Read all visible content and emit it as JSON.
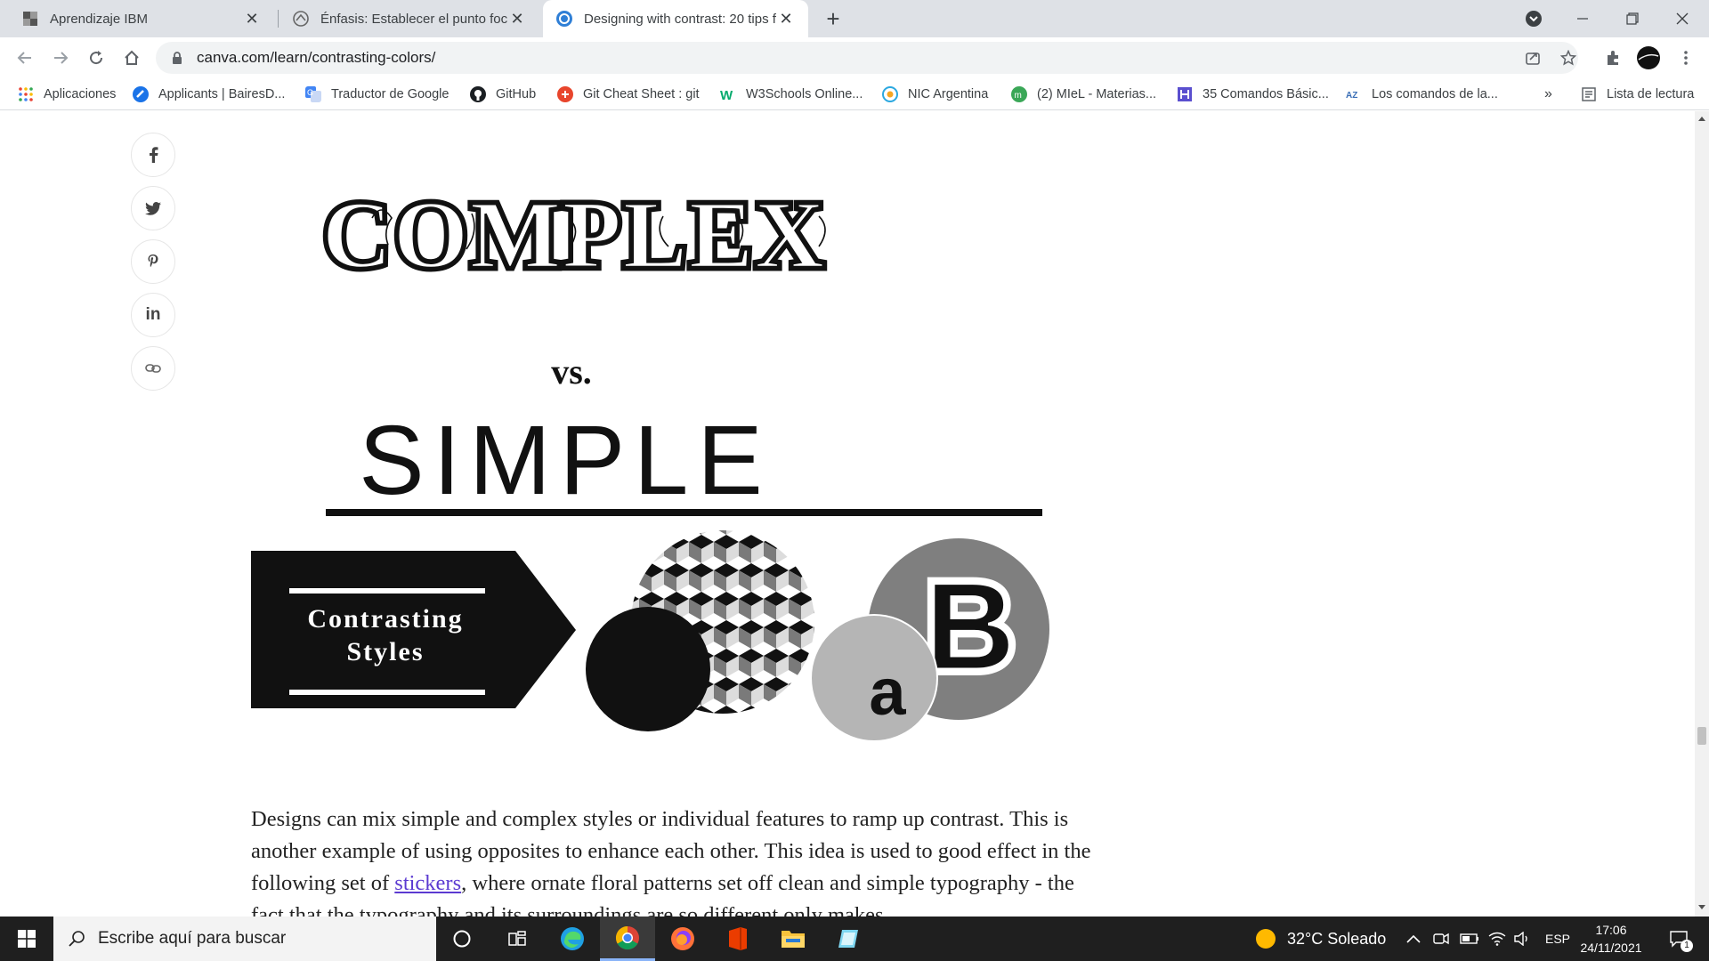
{
  "browser": {
    "tabs": [
      {
        "title": "Aprendizaje IBM",
        "active": false,
        "favicon": "ibm-icon"
      },
      {
        "title": "Énfasis: Establecer el punto focal",
        "active": false,
        "favicon": "atlas-icon"
      },
      {
        "title": "Designing with contrast: 20 tips f",
        "active": true,
        "favicon": "canva-icon"
      }
    ],
    "new_tab": "+",
    "url": "canva.com/learn/contrasting-colors/",
    "bookmarks": [
      {
        "label": "Aplicaciones",
        "icon": "apps-grid-icon"
      },
      {
        "label": "Applicants | BairesD...",
        "icon": "bairesdev-icon"
      },
      {
        "label": "Traductor de Google",
        "icon": "translate-icon"
      },
      {
        "label": "GitHub",
        "icon": "github-icon"
      },
      {
        "label": "Git Cheat Sheet : git",
        "icon": "git-icon"
      },
      {
        "label": "W3Schools Online...",
        "icon": "w3schools-icon"
      },
      {
        "label": "NIC Argentina",
        "icon": "nic-icon"
      },
      {
        "label": "(2) MIeL - Materias...",
        "icon": "miel-icon"
      },
      {
        "label": "35 Comandos Básic...",
        "icon": "hackr-icon"
      },
      {
        "label": "Los comandos de la...",
        "icon": "az-icon"
      }
    ],
    "more_bookmarks": "»",
    "reading_list": "Lista de lectura"
  },
  "page": {
    "graphic": {
      "top_word": "COMPLEX",
      "middle_word": "vs.",
      "bottom_word": "SIMPLE",
      "badge_line1": "Contrasting",
      "badge_line2": "Styles",
      "letter_small": "a",
      "letter_big": "B"
    },
    "paragraph": {
      "part1": "Designs can mix simple and complex styles or individual features to ramp up contrast. This is another example of using opposites to enhance each other. This idea is used to good effect in the following set of ",
      "link": "stickers",
      "part2": ", where ornate floral patterns set off clean and simple typography - the fact that the typography and its surroundings are so different only makes"
    },
    "share_buttons": [
      "f",
      "twitter",
      "p",
      "in",
      "link"
    ]
  },
  "taskbar": {
    "search_placeholder": "Escribe aquí para buscar",
    "weather": "32°C  Soleado",
    "language": "ESP",
    "time": "17:06",
    "date": "24/11/2021",
    "notifications": "1"
  }
}
